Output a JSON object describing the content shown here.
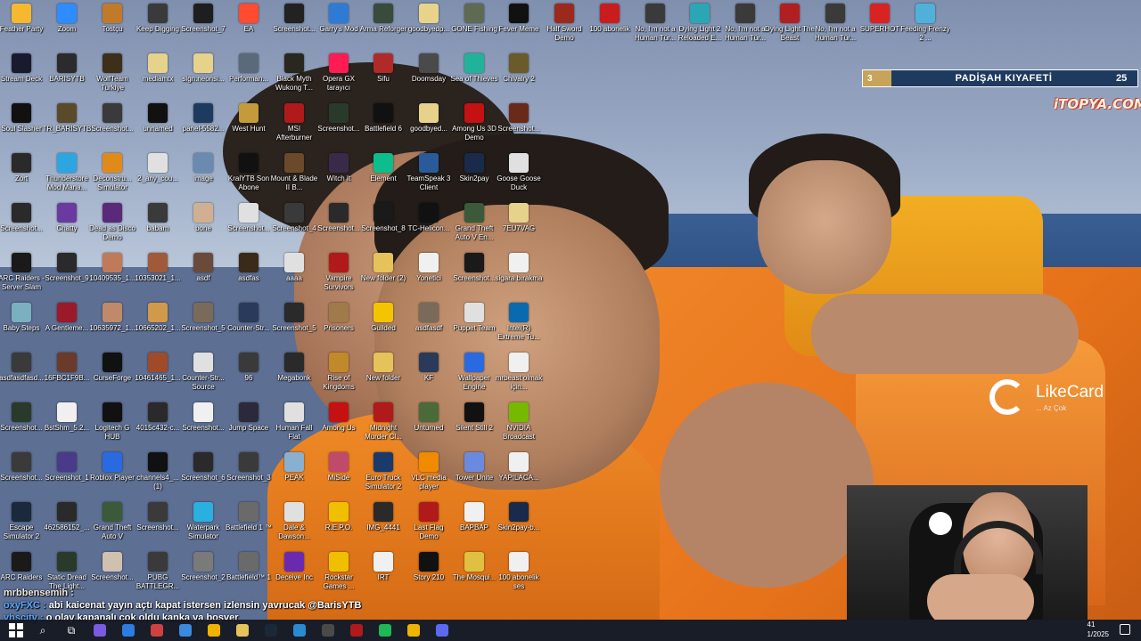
{
  "desktop_icons": [
    {
      "label": "Feather Party",
      "color": "#f5b82e"
    },
    {
      "label": "Zoom",
      "color": "#2d8cff"
    },
    {
      "label": "Tostçu",
      "color": "#c07a2a"
    },
    {
      "label": "Keep Digging",
      "color": "#3a3a3a"
    },
    {
      "label": "Screenshot_7",
      "color": "#1e1e1e"
    },
    {
      "label": "EA",
      "color": "#ff4c2e"
    },
    {
      "label": "Screenshot...",
      "color": "#222222"
    },
    {
      "label": "Garry's Mod",
      "color": "#2e7bd6"
    },
    {
      "label": "Arma Reforger",
      "color": "#394b3a"
    },
    {
      "label": "goodbyedp...",
      "color": "#e9d38a"
    },
    {
      "label": "GONE Fishing",
      "color": "#5e6a52"
    },
    {
      "label": "Fever Meme",
      "color": "#111111"
    },
    {
      "label": "Half Sword Demo",
      "color": "#9b2a1c"
    },
    {
      "label": "100 abonelik",
      "color": "#c91d1d"
    },
    {
      "label": "No, I'm not a Human Tür...",
      "color": "#3a3a3a"
    },
    {
      "label": "Dying Light 2 Reloaded E...",
      "color": "#2ba6b4"
    },
    {
      "label": "No, I'm not a Human Tür...",
      "color": "#3a3a3a"
    },
    {
      "label": "Dying Light The Beast",
      "color": "#b02020"
    },
    {
      "label": "No, I'm not a Human Tür...",
      "color": "#3a3a3a"
    },
    {
      "label": "SUPERHOT",
      "color": "#d92323"
    },
    {
      "label": "Feeding Frenzy 2 ...",
      "color": "#4fb0d9"
    },
    {
      "label": "Stream Deck",
      "color": "#1a1a2e"
    },
    {
      "label": "BARISYTB",
      "color": "#2b2b2b"
    },
    {
      "label": "WolfTeam Turkiye",
      "color": "#3e2f1a"
    },
    {
      "label": "mediamtx",
      "color": "#e6d28a"
    },
    {
      "label": "sign.neonsi...",
      "color": "#e6d28a"
    },
    {
      "label": "Performan...",
      "color": "#5a6a7a"
    },
    {
      "label": "Black Myth Wukong T...",
      "color": "#2a2620"
    },
    {
      "label": "Opera GX tarayıcı",
      "color": "#ff1b54"
    },
    {
      "label": "Sifu",
      "color": "#b02a2a"
    },
    {
      "label": "Doomsday",
      "color": "#4a4a4a"
    },
    {
      "label": "Sea of Thieves",
      "color": "#20b39a"
    },
    {
      "label": "Chivalry 2",
      "color": "#6b5a2a"
    },
    {
      "label": "Soul Slasher",
      "color": "#111111"
    },
    {
      "label": "TR_BARISYTB",
      "color": "#5a4a2a"
    },
    {
      "label": "Screenshot...",
      "color": "#3a3a3a"
    },
    {
      "label": "unnamed",
      "color": "#111111"
    },
    {
      "label": "panel-5582...",
      "color": "#1e3a5f"
    },
    {
      "label": "West Hunt",
      "color": "#c49a3a"
    },
    {
      "label": "MSI Afterburner",
      "color": "#b01a1a"
    },
    {
      "label": "Screenshot...",
      "color": "#2a3a2a"
    },
    {
      "label": "Battlefield 6",
      "color": "#111111"
    },
    {
      "label": "goodbyed...",
      "color": "#e6d28a"
    },
    {
      "label": "Among Us 3D Demo",
      "color": "#c51111"
    },
    {
      "label": "Screenshot...",
      "color": "#6a2a1a"
    },
    {
      "label": "Zort",
      "color": "#2a2a2a"
    },
    {
      "label": "Thunderstore Mod Mana...",
      "color": "#2ba6e0"
    },
    {
      "label": "Deconstru... Simulator",
      "color": "#e08a1a"
    },
    {
      "label": "2_any_cou...",
      "color": "#e0e0e0"
    },
    {
      "label": "image",
      "color": "#6a8ab0"
    },
    {
      "label": "KralYTB Son Abone",
      "color": "#111111"
    },
    {
      "label": "Mount & Blade II B...",
      "color": "#6a4a2a"
    },
    {
      "label": "Witch It",
      "color": "#3a2a4a"
    },
    {
      "label": "Element",
      "color": "#0dbd8b"
    },
    {
      "label": "TeamSpeak 3 Client",
      "color": "#2a5a9a"
    },
    {
      "label": "Skin2pay",
      "color": "#1a2a4a"
    },
    {
      "label": "Goose Goose Duck",
      "color": "#e0e0e0"
    },
    {
      "label": "Screenshot...",
      "color": "#2a2a2a"
    },
    {
      "label": "Chatty",
      "color": "#6a3aa0"
    },
    {
      "label": "Dead as Disco Demo",
      "color": "#5a2a7a"
    },
    {
      "label": "babam",
      "color": "#3a3a3a"
    },
    {
      "label": "bone",
      "color": "#d0b090"
    },
    {
      "label": "Screenshot...",
      "color": "#e0e0e0"
    },
    {
      "label": "Screenshot_4",
      "color": "#3a3a3a"
    },
    {
      "label": "Screenshot...",
      "color": "#2a2a2a"
    },
    {
      "label": "Screenshot_8",
      "color": "#1a1a1a"
    },
    {
      "label": "TC-Helicon...",
      "color": "#111111"
    },
    {
      "label": "Grand Theft Auto V En...",
      "color": "#3a5a3a"
    },
    {
      "label": "7EU7VAG",
      "color": "#e6d28a"
    },
    {
      "label": "ARC Raiders - Server Slam",
      "color": "#1a1a1a"
    },
    {
      "label": "Screenshot_9",
      "color": "#2a2a2a"
    },
    {
      "label": "10409535_1...",
      "color": "#c07a5a"
    },
    {
      "label": "10353021_1...",
      "color": "#a05a3a"
    },
    {
      "label": "asdf",
      "color": "#6a4a3a"
    },
    {
      "label": "asdfas",
      "color": "#3a2a1a"
    },
    {
      "label": "aaaa",
      "color": "#e0e0e0"
    },
    {
      "label": "Vampire Survivors",
      "color": "#b01a1a"
    },
    {
      "label": "New folder (2)",
      "color": "#e6c25a"
    },
    {
      "label": "Yonetici",
      "color": "#f0f0f0"
    },
    {
      "label": "Screenshot...",
      "color": "#1a1a1a"
    },
    {
      "label": "sigara bırakma",
      "color": "#f0f0f0"
    },
    {
      "label": "Baby Steps",
      "color": "#7ab0c0"
    },
    {
      "label": "A Gentleme...",
      "color": "#9a1a2a"
    },
    {
      "label": "10635972_1...",
      "color": "#c08a6a"
    },
    {
      "label": "10665202_1...",
      "color": "#d09a4a"
    },
    {
      "label": "Screenshot_5",
      "color": "#7a6a5a"
    },
    {
      "label": "Counter-Str...",
      "color": "#2a3a5a"
    },
    {
      "label": "Screenshot_5",
      "color": "#2a2a2a"
    },
    {
      "label": "Prisoners",
      "color": "#a07a4a"
    },
    {
      "label": "Guilded",
      "color": "#f5c400"
    },
    {
      "label": "asdfasdf",
      "color": "#7a6a5a"
    },
    {
      "label": "Puppet Team",
      "color": "#e0e0e0"
    },
    {
      "label": "Intel(R) Extreme Tu...",
      "color": "#0a6ab0"
    },
    {
      "label": "asdfasdfasd...",
      "color": "#3a3a3a"
    },
    {
      "label": "16FBC1F9B...",
      "color": "#6a3a2a"
    },
    {
      "label": "CurseForge",
      "color": "#111111"
    },
    {
      "label": "10461465_1...",
      "color": "#a04a2a"
    },
    {
      "label": "Counter-Str... Source",
      "color": "#e0e0e0"
    },
    {
      "label": "96",
      "color": "#3a3a3a"
    },
    {
      "label": "Megabonk",
      "color": "#2a2a2a"
    },
    {
      "label": "Rise of Kingdoms",
      "color": "#c08a2a"
    },
    {
      "label": "New folder",
      "color": "#e6c25a"
    },
    {
      "label": "KF",
      "color": "#2a3a5a"
    },
    {
      "label": "Wallpaper Engine",
      "color": "#2a6ae0"
    },
    {
      "label": "mrbeast olmak için...",
      "color": "#f0f0f0"
    },
    {
      "label": "Screenshot...",
      "color": "#2a3a2a"
    },
    {
      "label": "BstShm_5.2...",
      "color": "#f0f0f0"
    },
    {
      "label": "Logitech G HUB",
      "color": "#111111"
    },
    {
      "label": "4015c432-c...",
      "color": "#2a2a2a"
    },
    {
      "label": "Screenshot...",
      "color": "#f0f0f0"
    },
    {
      "label": "Jump Space",
      "color": "#2a2a3a"
    },
    {
      "label": "Human Fall Flat",
      "color": "#e0e0e0"
    },
    {
      "label": "Among Us",
      "color": "#c51111"
    },
    {
      "label": "Midnight Murder Cl...",
      "color": "#b01a1a"
    },
    {
      "label": "Unturned",
      "color": "#4a6a3a"
    },
    {
      "label": "Silent Still 2",
      "color": "#111111"
    },
    {
      "label": "NVIDIA Broadcast",
      "color": "#76b900"
    },
    {
      "label": "Screenshot...",
      "color": "#3a3a3a"
    },
    {
      "label": "Screenshot_1",
      "color": "#4a3a8a"
    },
    {
      "label": "Roblox Player",
      "color": "#2a6ae0"
    },
    {
      "label": "channels4_... (1)",
      "color": "#111111"
    },
    {
      "label": "Screenshot_6",
      "color": "#2a2a2a"
    },
    {
      "label": "Screenshot_3",
      "color": "#3a3a3a"
    },
    {
      "label": "PEAK",
      "color": "#8ab0d0"
    },
    {
      "label": "MiSide",
      "color": "#c04a6a"
    },
    {
      "label": "Euro Truck Simulator 2",
      "color": "#1a3a6a"
    },
    {
      "label": "VLC media player",
      "color": "#f08a00"
    },
    {
      "label": "Tower Unite",
      "color": "#6a8ae0"
    },
    {
      "label": "YAPILACA...",
      "color": "#f0f0f0"
    },
    {
      "label": "Escape Simulator 2",
      "color": "#1a2a3a"
    },
    {
      "label": "462586152_...",
      "color": "#2a2a2a"
    },
    {
      "label": "Grand Theft Auto V",
      "color": "#3a5a3a"
    },
    {
      "label": "Screenshot...",
      "color": "#3a3a3a"
    },
    {
      "label": "Waterpark Simulator",
      "color": "#2ab0e0"
    },
    {
      "label": "Battlefield 1 ™",
      "color": "#6a6a6a"
    },
    {
      "label": "Dale & Dawson...",
      "color": "#e0e0e0"
    },
    {
      "label": "R.E.P.O.",
      "color": "#f0c000"
    },
    {
      "label": "IMG_4441",
      "color": "#2a2a2a"
    },
    {
      "label": "Last Flag Demo",
      "color": "#b01a1a"
    },
    {
      "label": "BAPBAP",
      "color": "#f0f0f0"
    },
    {
      "label": "Skin2pay-b...",
      "color": "#1a2a4a"
    },
    {
      "label": "ARC Raiders",
      "color": "#1a1a1a"
    },
    {
      "label": "Static Dread The Light...",
      "color": "#2a3a2a"
    },
    {
      "label": "Screenshot...",
      "color": "#d0c0b0"
    },
    {
      "label": "PUBG BATTLEGR...",
      "color": "#3a3a3a"
    },
    {
      "label": "Screenshot_2",
      "color": "#7a7a7a"
    },
    {
      "label": "Battlefield™ 1",
      "color": "#6a6a6a"
    },
    {
      "label": "Deceive Inc",
      "color": "#6a2ab0"
    },
    {
      "label": "Rockstar Games ...",
      "color": "#f0c000"
    },
    {
      "label": "IRT",
      "color": "#f0f0f0"
    },
    {
      "label": "Story 210",
      "color": "#111111"
    },
    {
      "label": "The Mosqui...",
      "color": "#e0c040"
    },
    {
      "label": "100 abonelik ses",
      "color": "#f0f0f0"
    }
  ],
  "overlays": {
    "padisah": {
      "rank": "3",
      "title": "PADİŞAH KIYAFETİ",
      "score": "25"
    },
    "itopya_logo": "iTOPYA.COM",
    "likecard": {
      "name": "LikeCard",
      "tagline": "... Az Çok"
    },
    "chat": [
      {
        "user": "mrbbensemih :",
        "message": ""
      },
      {
        "user": "oxyFXC :",
        "message": "abi kaicenat yayın açtı kapat istersen izlensin yavrucak @BarisYTB"
      },
      {
        "user": "vhscity :",
        "message": "o olay kapanalı çok oldu kanka ya boşver"
      }
    ]
  },
  "taskbar": {
    "apps": [
      {
        "name": "search-icon",
        "glyph": "⌕",
        "color": "#ffffff"
      },
      {
        "name": "task-view-icon",
        "glyph": "⧉",
        "color": "#ffffff"
      },
      {
        "name": "app-icon",
        "glyph": "",
        "color": "#7a5ae0"
      },
      {
        "name": "app-icon",
        "glyph": "",
        "color": "#2b7de0"
      },
      {
        "name": "app-icon",
        "glyph": "",
        "color": "#d04040"
      },
      {
        "name": "app-icon",
        "glyph": "",
        "color": "#3a8ae0"
      },
      {
        "name": "chrome-icon",
        "glyph": "",
        "color": "#f0b400"
      },
      {
        "name": "folder-icon",
        "glyph": "",
        "color": "#e6c25a"
      },
      {
        "name": "steam-icon",
        "glyph": "",
        "color": "#1b2838"
      },
      {
        "name": "app-icon",
        "glyph": "",
        "color": "#2a8ad0"
      },
      {
        "name": "app-icon",
        "glyph": "",
        "color": "#4a4a4a"
      },
      {
        "name": "app-icon",
        "glyph": "",
        "color": "#b01a1a"
      },
      {
        "name": "spotify-icon",
        "glyph": "",
        "color": "#1db954"
      },
      {
        "name": "chrome-icon",
        "glyph": "",
        "color": "#f0b400"
      },
      {
        "name": "app-icon",
        "glyph": "",
        "color": "#5a6af0"
      }
    ],
    "clock_time": "41",
    "clock_date": "1/2025"
  }
}
